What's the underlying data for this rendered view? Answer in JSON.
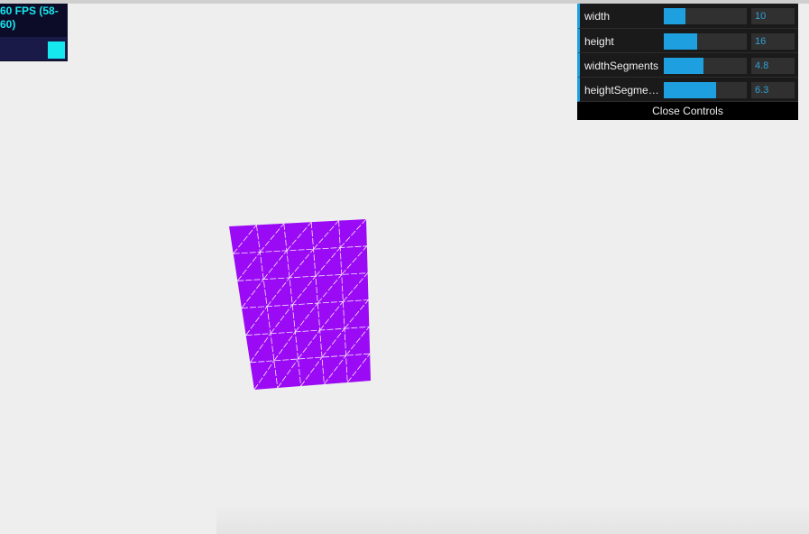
{
  "stats": {
    "fps_text": "60 FPS (58-60)",
    "color": "#16e8f0"
  },
  "controls": {
    "items": [
      {
        "label": "width",
        "value": "10",
        "fill_fraction": 0.26
      },
      {
        "label": "height",
        "value": "16",
        "fill_fraction": 0.4
      },
      {
        "label": "widthSegments",
        "value": "4.8",
        "fill_fraction": 0.48
      },
      {
        "label": "heightSegme…",
        "value": "6.3",
        "fill_fraction": 0.63
      }
    ],
    "close_label": "Close Controls",
    "accent": "#1ea0e0"
  },
  "mesh": {
    "color": "#9b0af5",
    "wire_color": "#ffffff"
  }
}
